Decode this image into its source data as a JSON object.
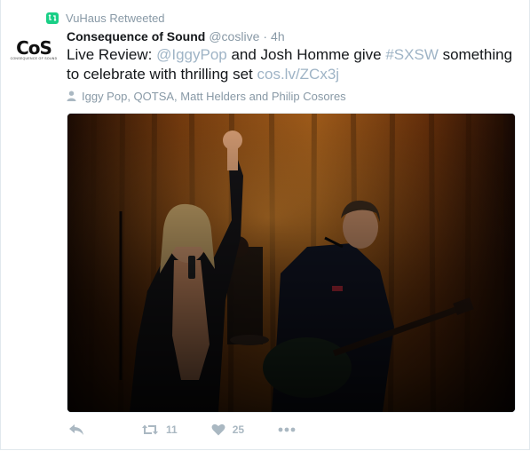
{
  "retweet": {
    "label": "VuHaus Retweeted"
  },
  "author": {
    "avatar_text": "CoS",
    "avatar_tagline": "CONSEQUENCE OF SOUND",
    "name": "Consequence of Sound",
    "handle": "@coslive",
    "separator": "·",
    "time": "4h"
  },
  "tweet": {
    "segments": [
      {
        "text": "Live Review: ",
        "link": false
      },
      {
        "text": "@IggyPop",
        "link": true
      },
      {
        "text": " and Josh Homme give ",
        "link": false
      },
      {
        "text": "#SXSW",
        "link": true
      },
      {
        "text": " something to celebrate with thrilling set ",
        "link": false
      },
      {
        "text": "cos.lv/ZCx3j",
        "link": true
      }
    ]
  },
  "tagged": {
    "text": "Iggy Pop, QOTSA, Matt Helders and Philip Cosores"
  },
  "actions": {
    "reply_icon": "reply-icon",
    "retweet_icon": "retweet-icon",
    "retweet_count": "11",
    "like_icon": "heart-icon",
    "like_count": "25",
    "more_icon": "more-icon"
  },
  "colors": {
    "retweet_badge": "#19cf86",
    "link": "#9fb4c6",
    "muted": "#8899a6",
    "action": "#aab8c2"
  }
}
